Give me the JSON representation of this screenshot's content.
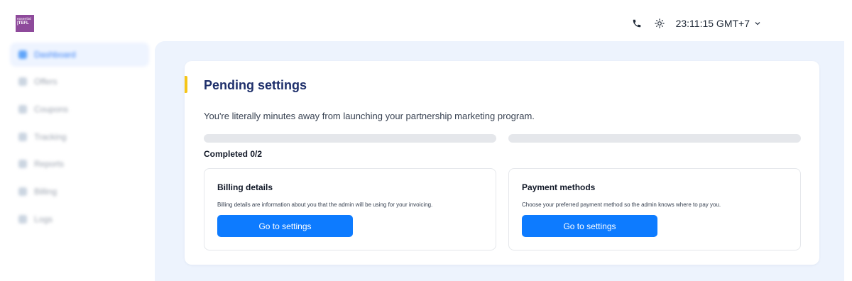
{
  "brand": {
    "line1": "essential",
    "line2": "|TEFL"
  },
  "header": {
    "clock_text": "23:11:15 GMT+7",
    "icons": [
      "phone-icon",
      "sun-icon",
      "chevron-down-icon"
    ]
  },
  "sidebar": {
    "items": [
      {
        "label": "Dashboard",
        "icon": "dashboard-icon",
        "active": true
      },
      {
        "label": "Offers",
        "icon": "offers-icon"
      },
      {
        "label": "Coupons",
        "icon": "coupons-icon"
      },
      {
        "label": "Tracking",
        "icon": "tracking-icon"
      },
      {
        "label": "Reports",
        "icon": "reports-icon"
      },
      {
        "label": "Billing",
        "icon": "billing-icon"
      },
      {
        "label": "Logs",
        "icon": "logs-icon"
      }
    ]
  },
  "pending": {
    "title": "Pending settings",
    "subtitle": "You're literally minutes away from launching your partnership marketing program.",
    "completed_label": "Completed 0/2",
    "progress": [
      0,
      0
    ],
    "steps": [
      {
        "title": "Billing details",
        "description": "Billing details are information about you that the admin will be using for your invoicing.",
        "button_label": "Go to settings"
      },
      {
        "title": "Payment methods",
        "description": "Choose your preferred payment method so the admin knows where to pay you.",
        "button_label": "Go to settings"
      }
    ]
  },
  "colors": {
    "accent": "#0d7bff",
    "title": "#1e2f6b",
    "highlight": "#f5c518",
    "main_bg": "#edf3fd"
  }
}
